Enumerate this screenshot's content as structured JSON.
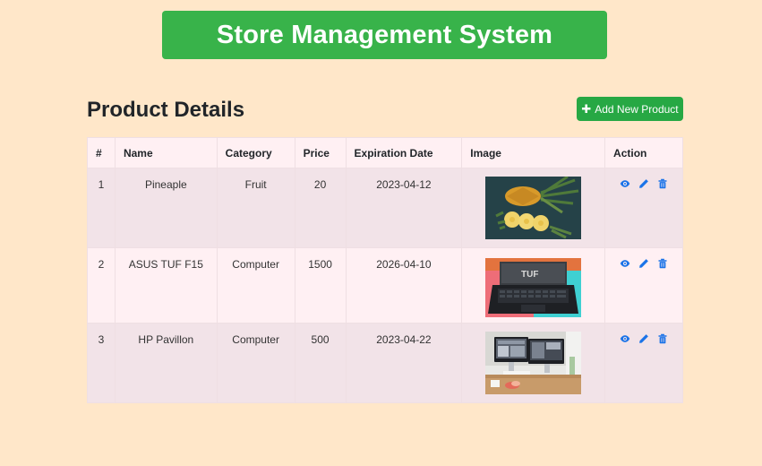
{
  "header": {
    "title": "Store Management System"
  },
  "main": {
    "title": "Product Details",
    "add_button_label": "Add New Product",
    "columns": [
      "#",
      "Name",
      "Category",
      "Price",
      "Expiration Date",
      "Image",
      "Action"
    ],
    "rows": [
      {
        "num": "1",
        "name": "Pineaple",
        "category": "Fruit",
        "price": "20",
        "expiration": "2023-04-12",
        "image": "pineapple-photo"
      },
      {
        "num": "2",
        "name": "ASUS TUF F15",
        "category": "Computer",
        "price": "1500",
        "expiration": "2026-04-10",
        "image": "laptop-photo"
      },
      {
        "num": "3",
        "name": "HP Pavillon",
        "category": "Computer",
        "price": "500",
        "expiration": "2023-04-22",
        "image": "desktop-photo"
      }
    ],
    "action_icons": [
      "eye-icon",
      "pencil-icon",
      "trash-icon"
    ]
  },
  "colors": {
    "background": "#ffe7c9",
    "banner": "#38b34a",
    "button": "#27a844",
    "icon": "#1a73e8"
  }
}
